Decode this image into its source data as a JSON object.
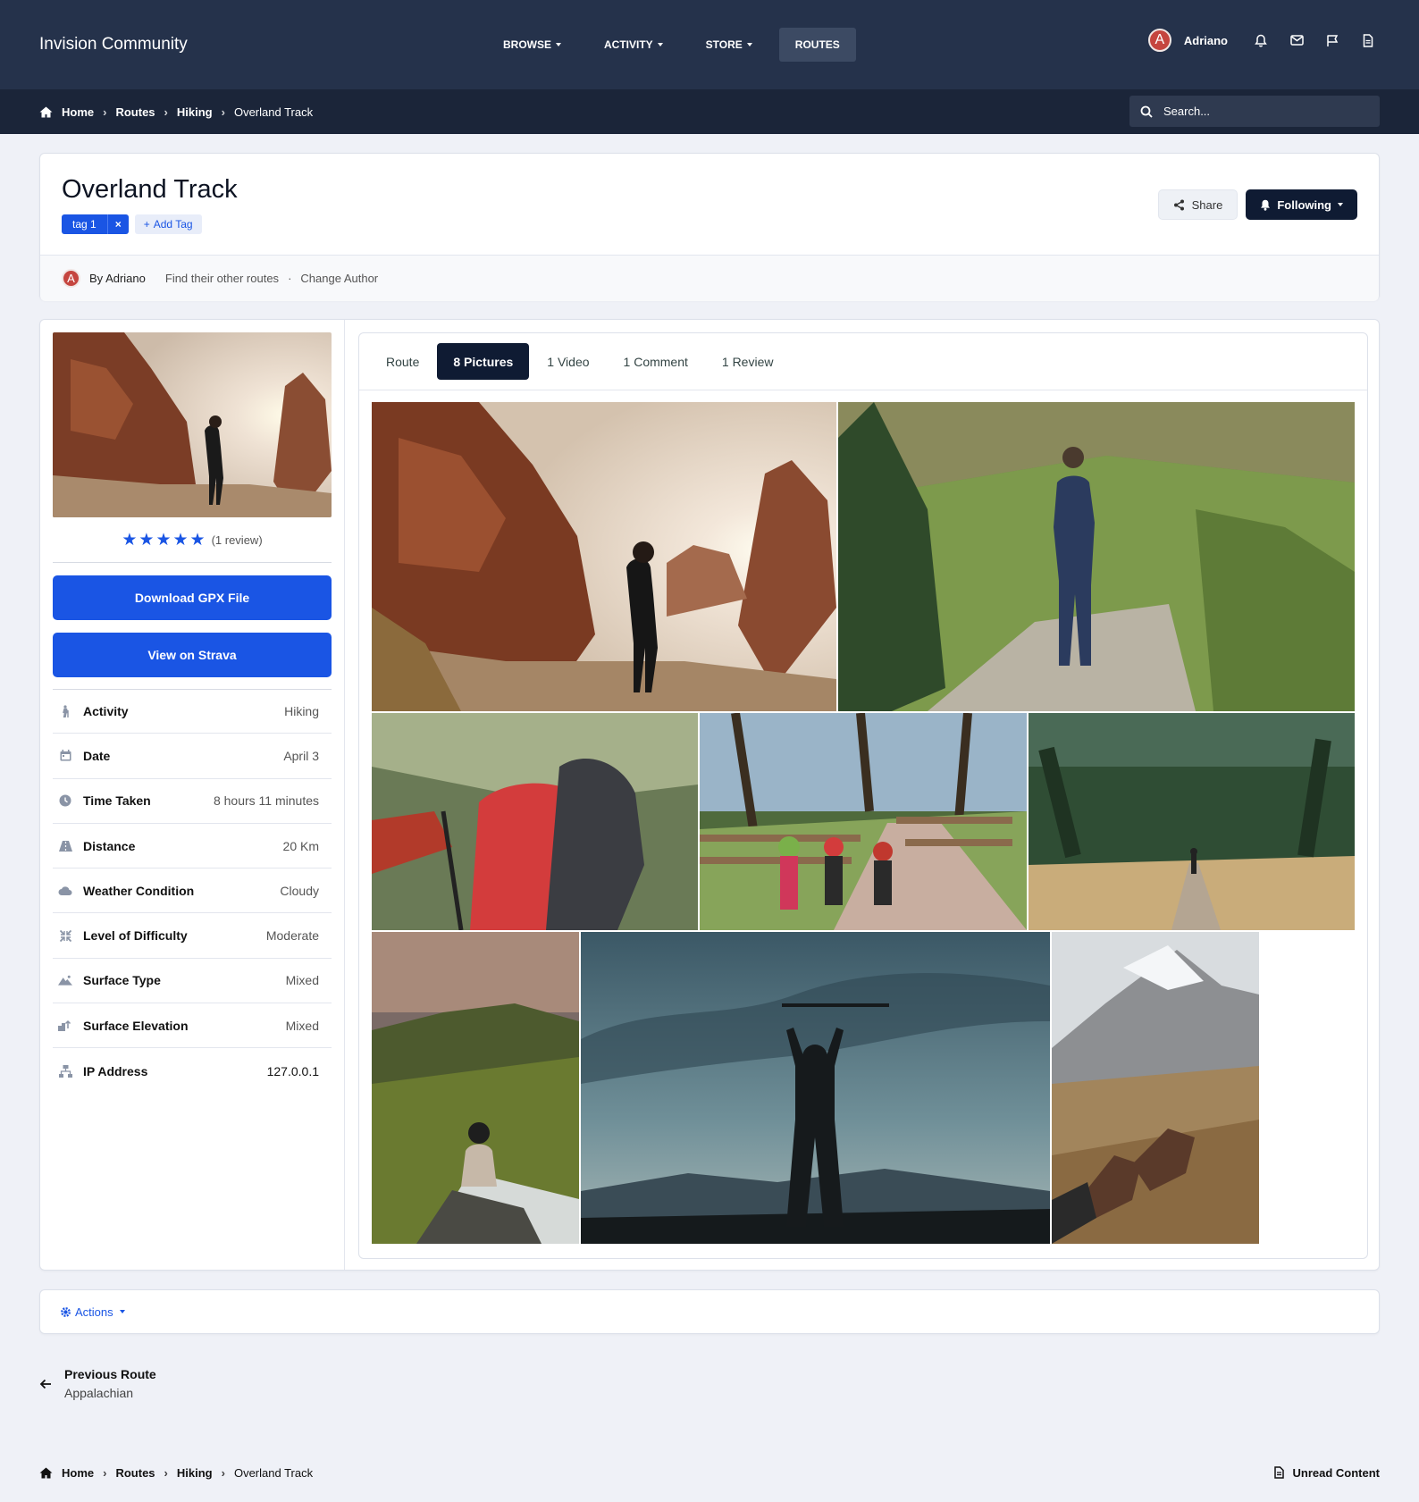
{
  "header": {
    "logo": "Invision Community",
    "nav": [
      {
        "label": "BROWSE",
        "dropdown": true,
        "active": false
      },
      {
        "label": "ACTIVITY",
        "dropdown": true,
        "active": false
      },
      {
        "label": "STORE",
        "dropdown": true,
        "active": false
      },
      {
        "label": "ROUTES",
        "dropdown": false,
        "active": true
      }
    ],
    "user": {
      "avatar_letter": "A",
      "name": "Adriano"
    }
  },
  "breadcrumb": {
    "items": [
      "Home",
      "Routes",
      "Hiking",
      "Overland Track"
    ]
  },
  "search": {
    "placeholder": "Search..."
  },
  "route": {
    "title": "Overland Track",
    "tag": "tag 1",
    "tag_remove": "×",
    "add_tag": "Add Tag",
    "share": "Share",
    "following": "Following",
    "by": "By Adriano",
    "avatar_letter": "A",
    "other_routes": "Find their other routes",
    "dot": "·",
    "change_author": "Change Author"
  },
  "sidebar": {
    "rating": 5,
    "review_count": "(1 review)",
    "download_gpx": "Download GPX File",
    "view_strava": "View on Strava",
    "facts": [
      {
        "label": "Activity",
        "value": "Hiking",
        "icon": "hiker-icon"
      },
      {
        "label": "Date",
        "value": "April 3",
        "icon": "calendar-icon"
      },
      {
        "label": "Time Taken",
        "value": "8 hours 11 minutes",
        "icon": "clock-icon"
      },
      {
        "label": "Distance",
        "value": "20 Km",
        "icon": "road-icon"
      },
      {
        "label": "Weather Condition",
        "value": "Cloudy",
        "icon": "cloud-icon"
      },
      {
        "label": "Level of Difficulty",
        "value": "Moderate",
        "icon": "compress-icon"
      },
      {
        "label": "Surface Type",
        "value": "Mixed",
        "icon": "mountain-icon"
      },
      {
        "label": "Surface Elevation",
        "value": "Mixed",
        "icon": "elevation-icon"
      },
      {
        "label": "IP Address",
        "value": "127.0.0.1",
        "icon": "network-icon"
      }
    ]
  },
  "tabs": [
    {
      "label": "Route",
      "active": false
    },
    {
      "label": "8 Pictures",
      "active": true
    },
    {
      "label": "1 Video",
      "active": false
    },
    {
      "label": "1 Comment",
      "active": false
    },
    {
      "label": "1 Review",
      "active": false
    }
  ],
  "gallery": [
    {
      "name": "photo-hiker-red-rocks"
    },
    {
      "name": "photo-hiker-green-hill"
    },
    {
      "name": "photo-red-backpack"
    },
    {
      "name": "photo-hikers-fence"
    },
    {
      "name": "photo-forest-path"
    },
    {
      "name": "photo-mountain-sitting"
    },
    {
      "name": "photo-silhouette-poles"
    },
    {
      "name": "photo-boots-mountain"
    }
  ],
  "actions": {
    "label": "Actions"
  },
  "previous": {
    "label": "Previous Route",
    "title": "Appalachian"
  },
  "footer": {
    "unread": "Unread Content"
  }
}
